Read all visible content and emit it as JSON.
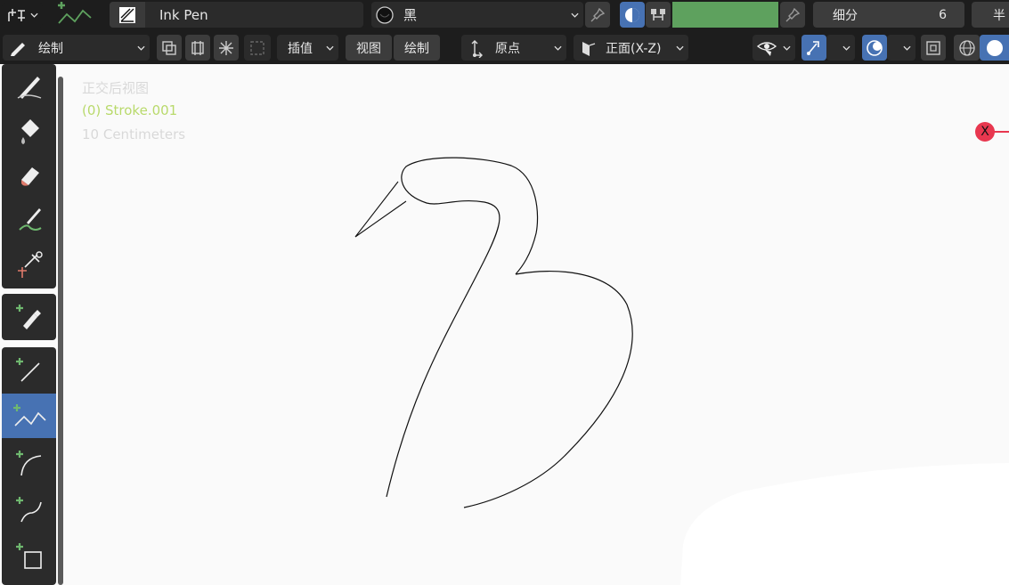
{
  "header": {
    "brush_name": "Ink Pen",
    "material_name": "黑",
    "subdivision_label": "细分",
    "subdivision_value": "6",
    "cut_label": "半"
  },
  "toolbar2": {
    "mode_label": "绘制",
    "interpolate_label": "插值",
    "view_label": "视图",
    "draw_label": "绘制",
    "pivot_label": "原点",
    "orientation_label": "正面(X-Z)"
  },
  "viewport": {
    "view_name": "正交后视图",
    "object_name": "(0) Stroke.001",
    "scale_text": "10 Centimeters",
    "axis_label": "X"
  },
  "colors": {
    "header_bg": "#1d1d1d",
    "button_bg": "#2b2b2b",
    "active_blue": "#4772b3",
    "stroke_green": "#5ea15e",
    "object_name_green": "#b8d96b",
    "axis_red": "#e8374f"
  },
  "tools": [
    {
      "name": "draw-tool-icon",
      "active": false
    },
    {
      "name": "fill-tool-icon",
      "active": false
    },
    {
      "name": "erase-tool-icon",
      "active": false
    },
    {
      "name": "tint-tool-icon",
      "active": false
    },
    {
      "name": "cutter-tool-icon",
      "active": false
    },
    {
      "name": "eyedropper-tool-icon",
      "active": false
    },
    {
      "name": "line-tool-icon",
      "active": false
    },
    {
      "name": "polyline-tool-icon",
      "active": true
    },
    {
      "name": "arc-tool-icon",
      "active": false
    },
    {
      "name": "curve-tool-icon",
      "active": false
    },
    {
      "name": "box-tool-icon",
      "active": false
    }
  ]
}
